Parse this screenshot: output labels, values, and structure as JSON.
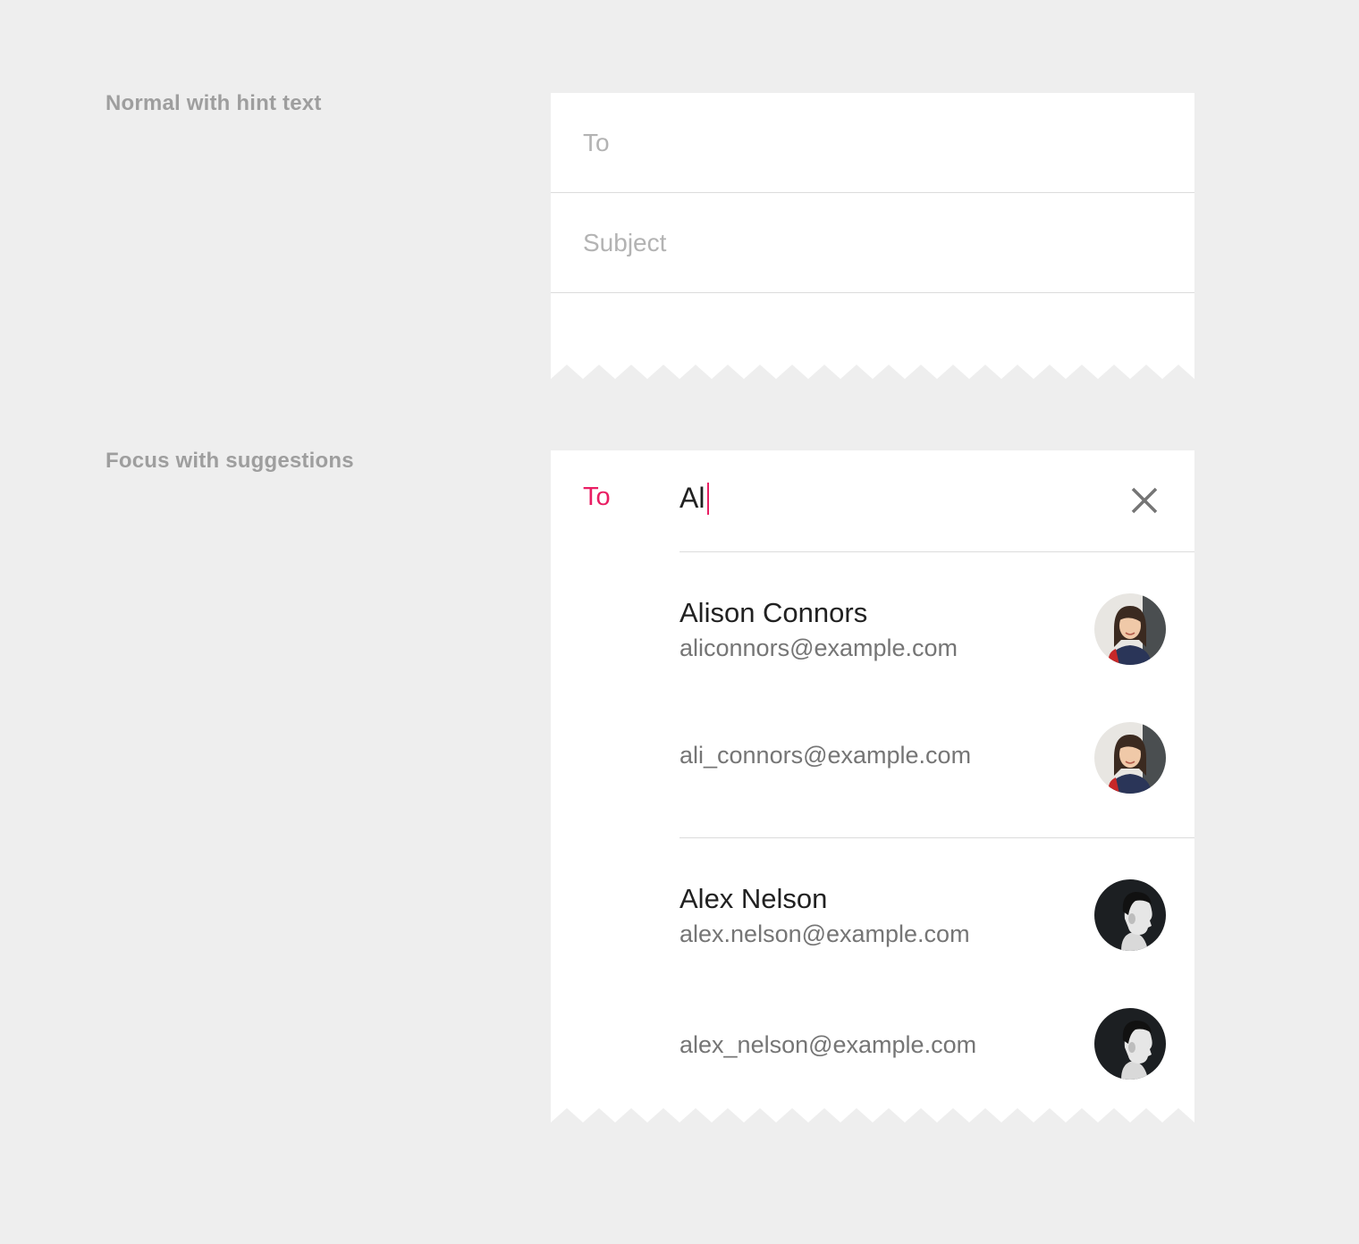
{
  "sections": {
    "normal_label": "Normal with hint text",
    "focus_label": "Focus with suggestions"
  },
  "normal_card": {
    "to_placeholder": "To",
    "subject_placeholder": "Subject"
  },
  "focus_card": {
    "to_label": "To",
    "typed_value": "Al",
    "clear_icon": "close-icon"
  },
  "suggestions": [
    {
      "name": "Alison Connors",
      "email": "aliconnors@example.com",
      "avatar": "alison-avatar"
    },
    {
      "name": "",
      "email": "ali_connors@example.com",
      "avatar": "alison-avatar"
    },
    {
      "name": "Alex Nelson",
      "email": "alex.nelson@example.com",
      "avatar": "alex-avatar"
    },
    {
      "name": "",
      "email": "alex_nelson@example.com",
      "avatar": "alex-avatar"
    }
  ],
  "colors": {
    "background": "#eeeeee",
    "card": "#ffffff",
    "accent": "#e91e63",
    "hint": "#b3b3b3",
    "section_label": "#9e9e9e",
    "secondary_text": "#757575",
    "primary_text": "#212121",
    "divider": "#dcdcdc"
  }
}
